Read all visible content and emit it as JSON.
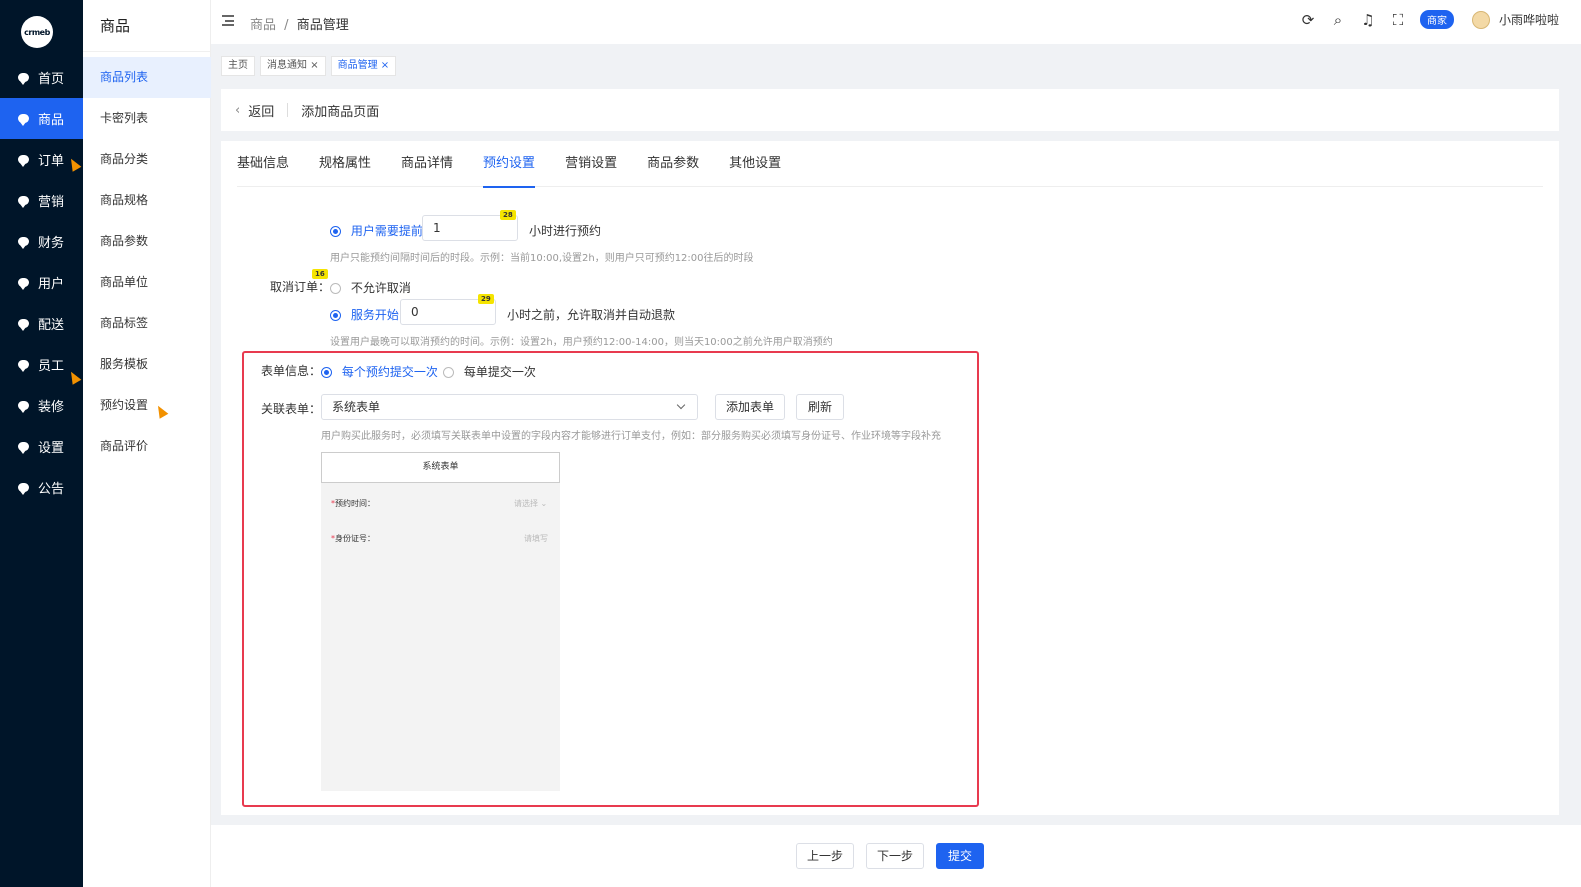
{
  "logo": {
    "text": "crmeb"
  },
  "nav1": [
    {
      "label": "首页"
    },
    {
      "label": "商品"
    },
    {
      "label": "订单"
    },
    {
      "label": "营销"
    },
    {
      "label": "财务"
    },
    {
      "label": "用户"
    },
    {
      "label": "配送"
    },
    {
      "label": "员工"
    },
    {
      "label": "装修"
    },
    {
      "label": "设置"
    },
    {
      "label": "公告"
    }
  ],
  "nav2": {
    "title": "商品",
    "items": [
      {
        "label": "商品列表"
      },
      {
        "label": "卡密列表"
      },
      {
        "label": "商品分类"
      },
      {
        "label": "商品规格"
      },
      {
        "label": "商品参数"
      },
      {
        "label": "商品单位"
      },
      {
        "label": "商品标签"
      },
      {
        "label": "服务模板"
      },
      {
        "label": "预约设置"
      },
      {
        "label": "商品评价"
      }
    ]
  },
  "header": {
    "breadcrumb_root": "商品",
    "breadcrumb_sep": "/",
    "breadcrumb_current": "商品管理",
    "badge": "商家",
    "username": "小雨哗啦啦",
    "icons": [
      "refresh-icon",
      "search-icon",
      "bell-icon",
      "fullscreen-icon"
    ]
  },
  "tags": [
    {
      "label": "主页"
    },
    {
      "label": "消息通知"
    },
    {
      "label": "商品管理"
    }
  ],
  "backbar": {
    "back": "返回",
    "title": "添加商品页面"
  },
  "tabs": [
    {
      "label": "基础信息"
    },
    {
      "label": "规格属性"
    },
    {
      "label": "商品详情"
    },
    {
      "label": "预约设置"
    },
    {
      "label": "营销设置"
    },
    {
      "label": "商品参数"
    },
    {
      "label": "其他设置"
    }
  ],
  "form": {
    "advance": {
      "option": "用户需要提前",
      "value": "1",
      "suffix": "小时进行预约",
      "note": "用户只能预约间隔时间后的时段。示例：当前10:00,设置2h，则用户只可预约12:00往后的时段",
      "marker": "28"
    },
    "cancel": {
      "label": "取消订单：",
      "label_marker": "16",
      "option_no": "不允许取消",
      "option_yes": "服务开始",
      "value": "0",
      "value_marker": "29",
      "suffix": "小时之前，允许取消并自动退款",
      "note": "设置用户最晚可以取消预约的时间。示例：设置2h，用户预约12:00-14:00，则当天10:00之前允许用户取消预约"
    },
    "form_info": {
      "label": "表单信息：",
      "option_each": "每个预约提交一次",
      "option_single": "每单提交一次"
    },
    "linked_form": {
      "label": "关联表单：",
      "selected": "系统表单",
      "add_button": "添加表单",
      "refresh_button": "刷新",
      "note": "用户购买此服务时，必须填写关联表单中设置的字段内容才能够进行订单支付，例如：部分服务购买必须填写身份证号、作业环境等字段补充"
    },
    "preview": {
      "title": "系统表单",
      "fields": [
        {
          "label": "预约时间：",
          "placeholder": "请选择"
        },
        {
          "label": "身份证号：",
          "placeholder": "请填写"
        }
      ]
    }
  },
  "footer": {
    "prev": "上一步",
    "next": "下一步",
    "submit": "提交"
  },
  "colors": {
    "primary": "#1e63f0",
    "sidebar": "#001529",
    "highlight_box": "#e83a4f"
  }
}
